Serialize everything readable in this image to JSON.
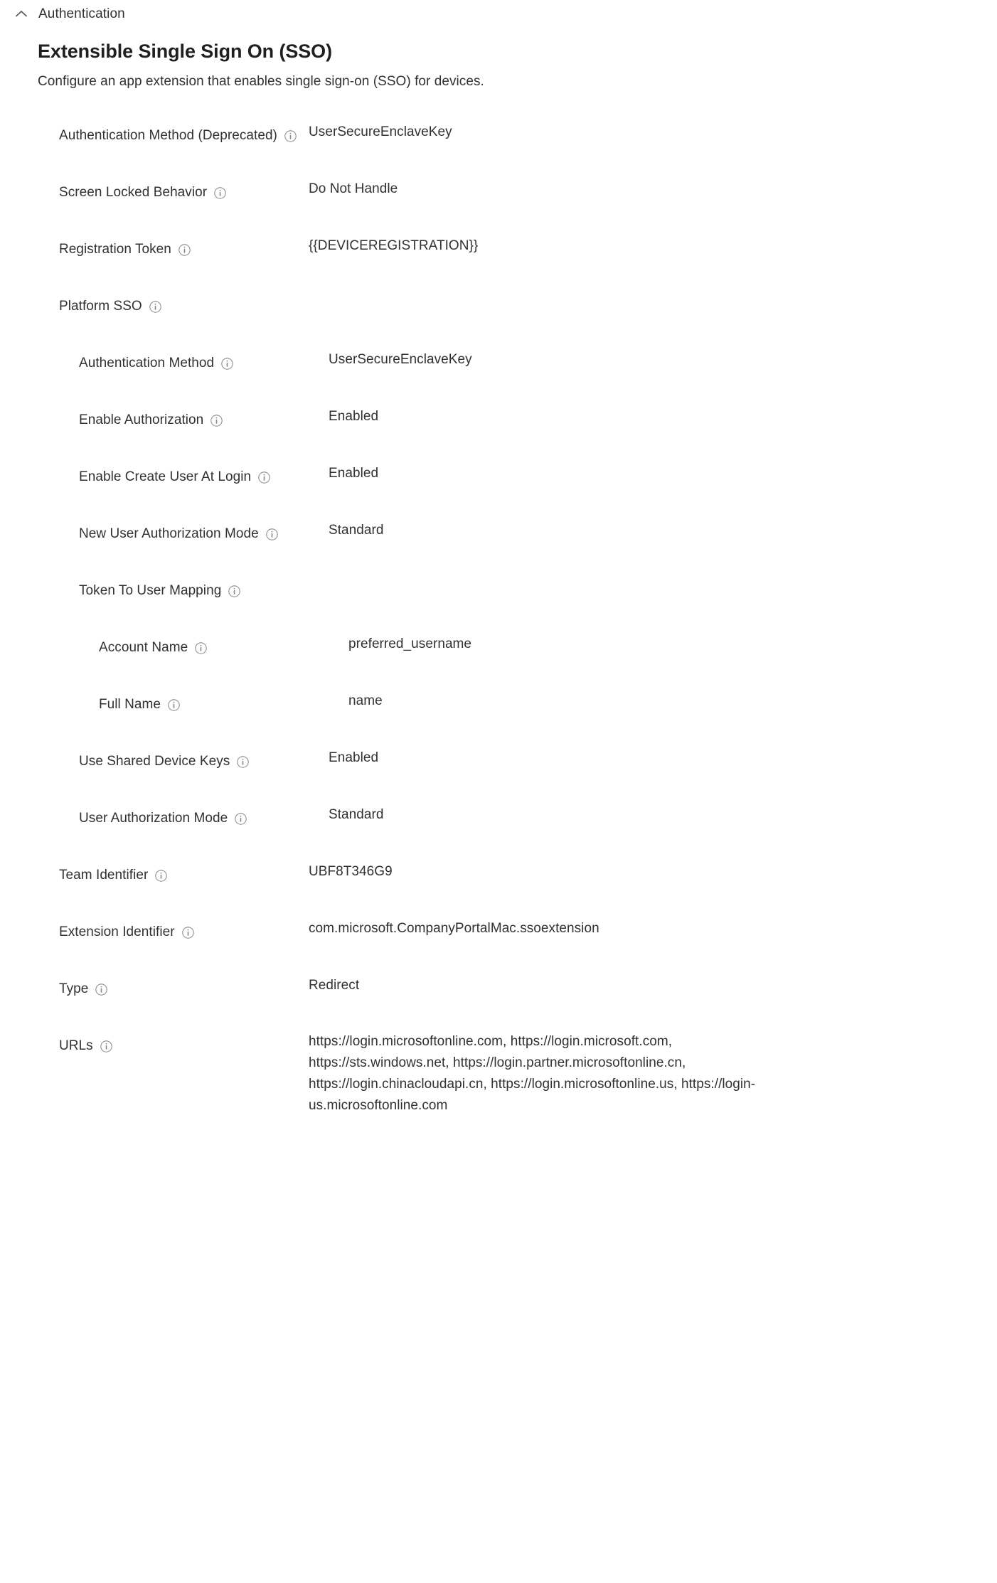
{
  "section": {
    "label": "Authentication",
    "collapse_icon": "chevron-up-icon",
    "expanded": true
  },
  "heading": {
    "title": "Extensible Single Sign On (SSO)",
    "description": "Configure an app extension that enables single sign-on (SSO) for devices."
  },
  "icons": {
    "info": "info-icon"
  },
  "colors": {
    "text": "#323130",
    "title": "#201f1e",
    "icon_outline": "#605e5c",
    "background": "#ffffff"
  },
  "settings": [
    {
      "label": "Authentication Method (Deprecated)",
      "value": "UserSecureEnclaveKey",
      "indent": 0,
      "info": true
    },
    {
      "label": "Screen Locked Behavior",
      "value": "Do Not Handle",
      "indent": 0,
      "info": true
    },
    {
      "label": "Registration Token",
      "value": "{{DEVICEREGISTRATION}}",
      "indent": 0,
      "info": true
    },
    {
      "label": "Platform SSO",
      "value": "",
      "indent": 0,
      "info": true
    },
    {
      "label": "Authentication Method",
      "value": "UserSecureEnclaveKey",
      "indent": 1,
      "info": true
    },
    {
      "label": "Enable Authorization",
      "value": "Enabled",
      "indent": 1,
      "info": true
    },
    {
      "label": "Enable Create User At Login",
      "value": "Enabled",
      "indent": 1,
      "info": true
    },
    {
      "label": "New User Authorization Mode",
      "value": "Standard",
      "indent": 1,
      "info": true
    },
    {
      "label": "Token To User Mapping",
      "value": "",
      "indent": 1,
      "info": true
    },
    {
      "label": "Account Name",
      "value": "preferred_username",
      "indent": 2,
      "info": true
    },
    {
      "label": "Full Name",
      "value": "name",
      "indent": 2,
      "info": true
    },
    {
      "label": "Use Shared Device Keys",
      "value": "Enabled",
      "indent": 1,
      "info": true
    },
    {
      "label": "User Authorization Mode",
      "value": "Standard",
      "indent": 1,
      "info": true
    },
    {
      "label": "Team Identifier",
      "value": "UBF8T346G9",
      "indent": 0,
      "info": true
    },
    {
      "label": "Extension Identifier",
      "value": "com.microsoft.CompanyPortalMac.ssoextension",
      "indent": 0,
      "info": true
    },
    {
      "label": "Type",
      "value": "Redirect",
      "indent": 0,
      "info": true
    },
    {
      "label": "URLs",
      "value": "https://login.microsoftonline.com, https://login.microsoft.com, https://sts.windows.net, https://login.partner.microsoftonline.cn, https://login.chinacloudapi.cn, https://login.microsoftonline.us, https://login-us.microsoftonline.com",
      "indent": 0,
      "info": true,
      "tall": true
    }
  ]
}
